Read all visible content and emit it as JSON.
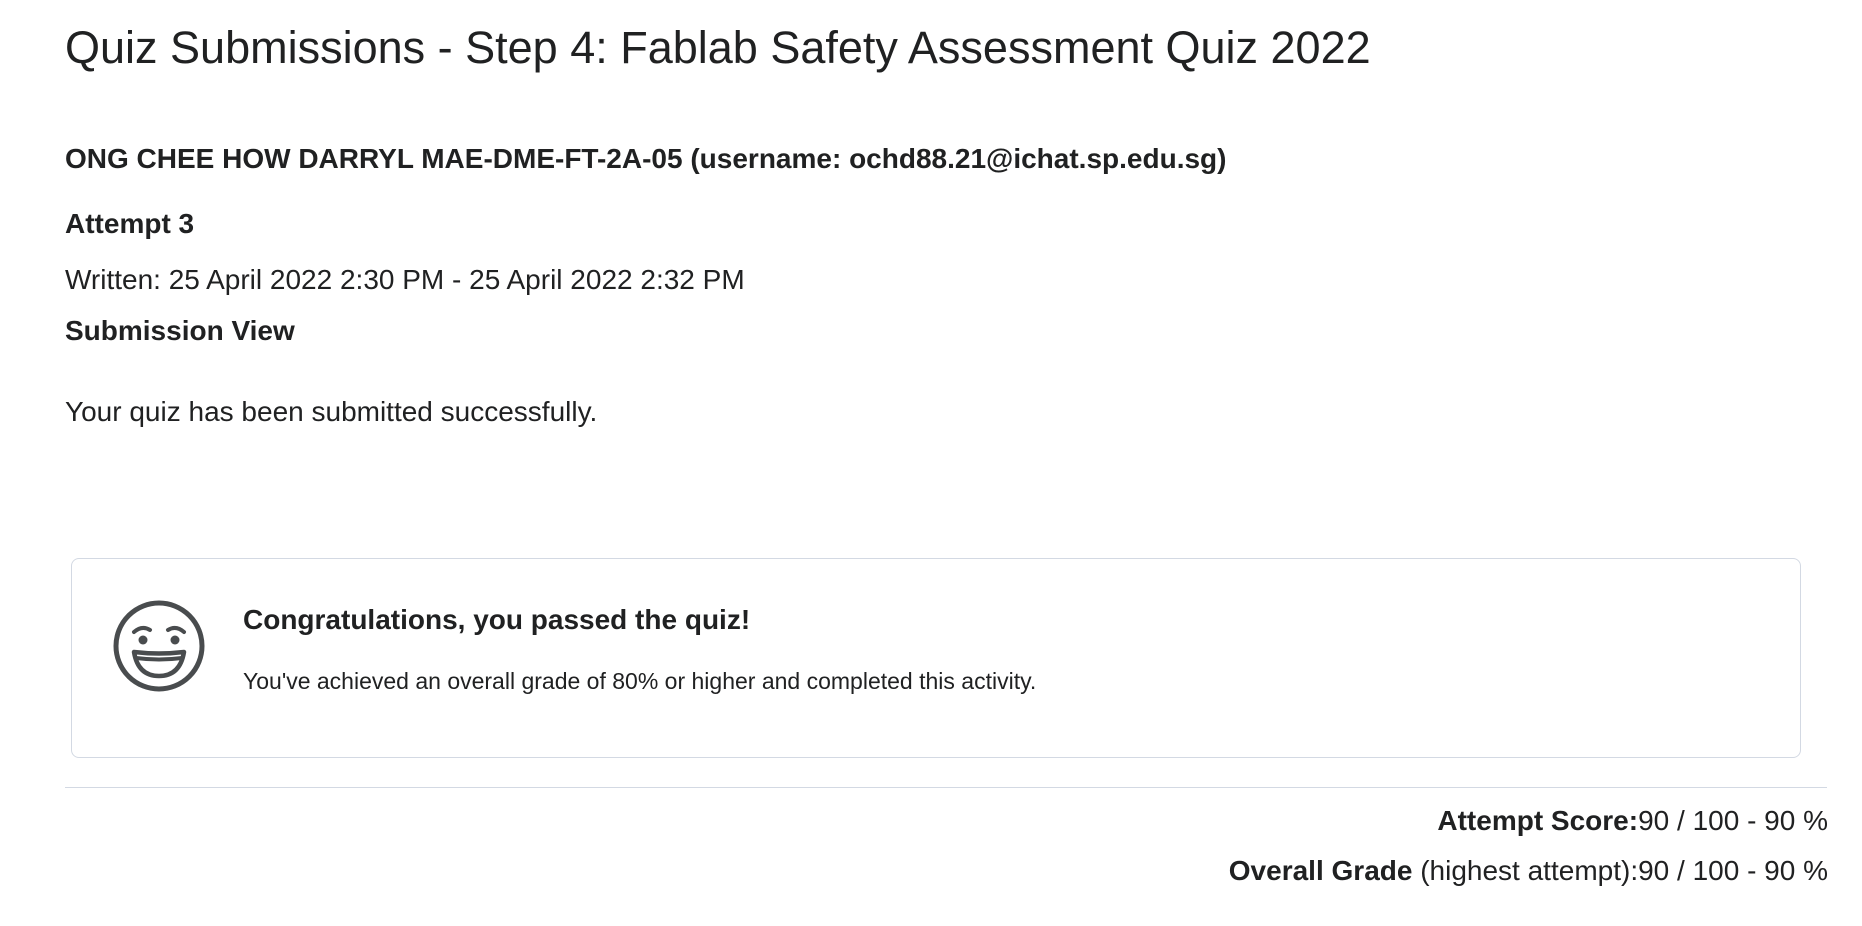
{
  "page_title": "Quiz Submissions - Step 4: Fablab Safety Assessment Quiz 2022",
  "user": {
    "line": "ONG CHEE HOW DARRYL MAE-DME-FT-2A-05 (username: ochd88.21@ichat.sp.edu.sg)"
  },
  "attempt": {
    "label": "Attempt 3",
    "written": "Written: 25 April 2022 2:30 PM - 25 April 2022 2:32 PM",
    "view_label": "Submission View",
    "success_message": "Your quiz has been submitted successfully."
  },
  "pass_card": {
    "icon": "smiley-face-icon",
    "heading": "Congratulations, you passed the quiz!",
    "text": "You've achieved an overall grade of 80% or higher and completed this activity."
  },
  "scores": {
    "attempt_label": "Attempt Score:",
    "attempt_value": "90 / 100 - 90 %",
    "overall_label": "Overall Grade",
    "overall_note": " (highest attempt):",
    "overall_value": "90 / 100 - 90 %"
  },
  "colors": {
    "text": "#202122",
    "border": "#d3d9e3",
    "icon": "#494c4e"
  }
}
